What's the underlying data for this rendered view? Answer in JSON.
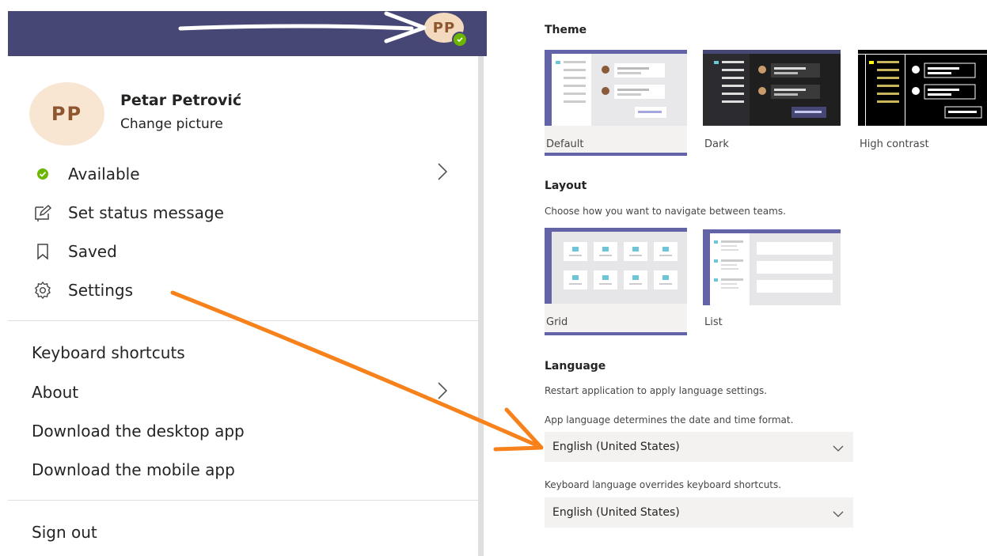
{
  "header": {
    "avatar_initials": "PP",
    "presence": "available"
  },
  "profile": {
    "initials": "PP",
    "name": "Petar Petrović",
    "change_picture": "Change picture"
  },
  "menu": {
    "status": "Available",
    "set_status": "Set status message",
    "saved": "Saved",
    "settings": "Settings",
    "keyboard_shortcuts": "Keyboard shortcuts",
    "about": "About",
    "download_desktop": "Download the desktop app",
    "download_mobile": "Download the mobile app",
    "sign_out": "Sign out"
  },
  "settings": {
    "theme": {
      "heading": "Theme",
      "options": [
        {
          "label": "Default",
          "selected": true
        },
        {
          "label": "Dark",
          "selected": false
        },
        {
          "label": "High contrast",
          "selected": false
        }
      ]
    },
    "layout": {
      "heading": "Layout",
      "description": "Choose how you want to navigate between teams.",
      "options": [
        {
          "label": "Grid",
          "selected": true
        },
        {
          "label": "List",
          "selected": false
        }
      ]
    },
    "language": {
      "heading": "Language",
      "restart_note": "Restart application to apply language settings.",
      "app_language_note": "App language determines the date and time format.",
      "app_language_value": "English (United States)",
      "keyboard_note": "Keyboard language overrides keyboard shortcuts.",
      "keyboard_value": "English (United States)"
    }
  },
  "colors": {
    "header_bg": "#464775",
    "accent": "#6264a7",
    "presence_green": "#6bb700",
    "avatar_bg": "#f8e5d2",
    "annotation_arrow": "#f7821b",
    "annotation_white_arrow": "#ffffff"
  },
  "icons": [
    "check-circle-icon",
    "edit-status-icon",
    "bookmark-icon",
    "gear-icon",
    "chevron-right-icon",
    "chevron-down-icon"
  ]
}
